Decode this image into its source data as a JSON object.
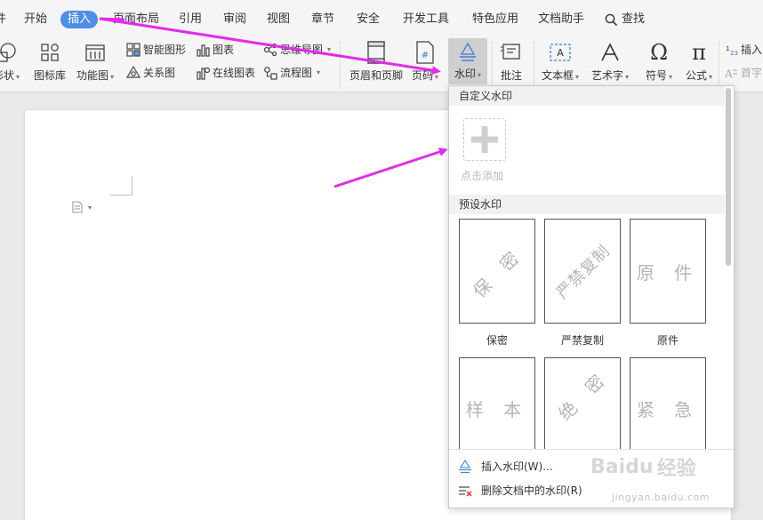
{
  "menu": {
    "partial_left": "件",
    "items": [
      "开始",
      "插入",
      "页面布局",
      "引用",
      "审阅",
      "视图",
      "章节",
      "安全",
      "开发工具",
      "特色应用",
      "文档助手"
    ],
    "active": "插入",
    "search": "查找"
  },
  "ribbon": {
    "shape_partial": "形状",
    "icon_library": "图标库",
    "function_chart": "功能图",
    "smart_shape": "智能图形",
    "chart": "图表",
    "mind_map": "思维导图",
    "relation_chart": "关系图",
    "online_chart": "在线图表",
    "flow_chart": "流程图",
    "header_footer": "页眉和页脚",
    "page_number": "页码",
    "watermark": "水印",
    "comment": "批注",
    "textbox": "文本框",
    "wordart": "艺术字",
    "symbol": "符号",
    "formula": "公式",
    "insert_number": "插入",
    "dropcap_partial": "首字"
  },
  "watermark_panel": {
    "custom_title": "自定义水印",
    "add_label": "点击添加",
    "preset_title": "预设水印",
    "presets": [
      {
        "text": "保 密",
        "caption": "保密"
      },
      {
        "text": "严禁复制",
        "caption": "严禁复制"
      },
      {
        "text": "原 件",
        "caption": "原件"
      },
      {
        "text": "样 本",
        "caption": ""
      },
      {
        "text": "绝 密",
        "caption": ""
      },
      {
        "text": "紧 急",
        "caption": ""
      }
    ],
    "insert_watermark": "插入水印(W)...",
    "delete_watermark": "删除文档中的水印(R)"
  },
  "brand": {
    "logo": "Baidu",
    "suffix": "经验",
    "url": "jingyan.baidu.com"
  },
  "colors": {
    "accent": "#4f8ee8",
    "arrow": "#e22ce8",
    "toolbar_bg": "#f5f5f5",
    "canvas_bg": "#e9e9e9"
  }
}
